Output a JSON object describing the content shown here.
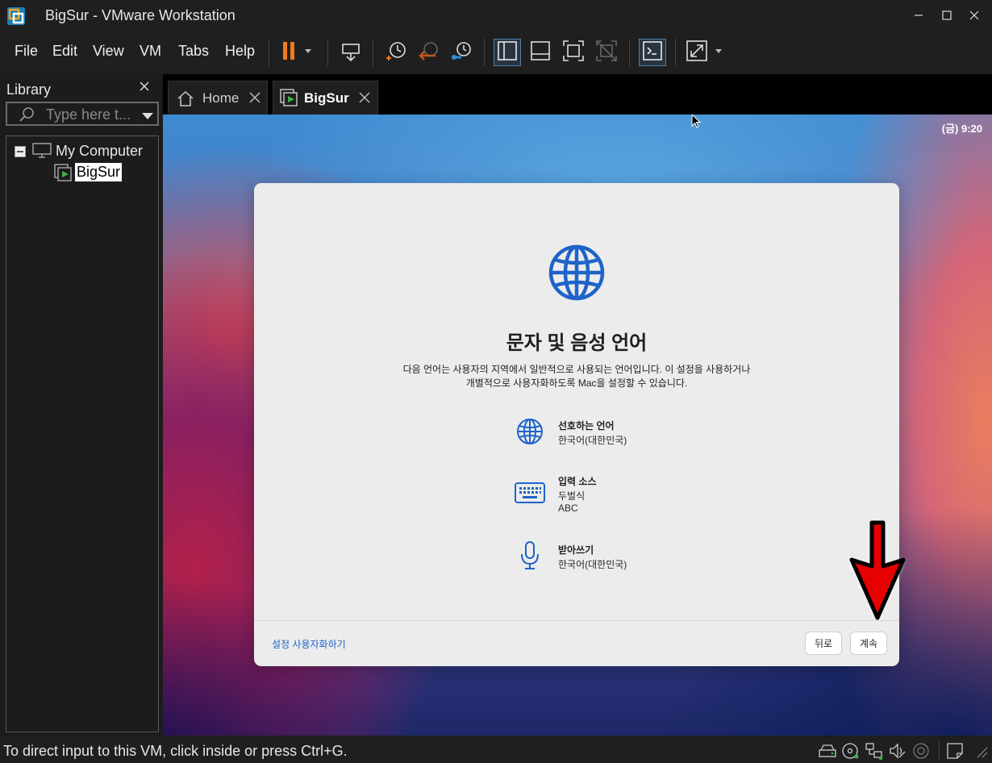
{
  "window": {
    "title": "BigSur - VMware Workstation"
  },
  "menu": {
    "items": [
      "File",
      "Edit",
      "View",
      "VM",
      "Tabs",
      "Help"
    ]
  },
  "toolbar": {
    "icons": [
      "pause-icon",
      "send-ctrl-alt-del-icon",
      "snapshot-take-icon",
      "snapshot-revert-icon",
      "snapshot-manager-icon",
      "show-library-icon",
      "thumbnail-bar-icon",
      "full-screen-icon",
      "unity-icon",
      "console-view-icon",
      "stretch-icon"
    ],
    "accent_pause": "#f07a1a"
  },
  "library": {
    "title": "Library",
    "search_placeholder": "Type here t...",
    "tree": {
      "root": "My Computer",
      "child": "BigSur"
    }
  },
  "tabs": [
    {
      "label": "Home",
      "active": false
    },
    {
      "label": "BigSur",
      "active": true
    }
  ],
  "vm": {
    "clock": "(금)  9:20",
    "dialog": {
      "title": "문자 및 음성 언어",
      "description_line1": "다음 언어는 사용자의 지역에서 일반적으로 사용되는 언어입니다. 이 설정을 사용하거나",
      "description_line2": "개별적으로 사용자화하도록 Mac을 설정할 수 있습니다.",
      "options": [
        {
          "icon": "globe-icon",
          "title": "선호하는 언어",
          "values": [
            "한국어(대한민국)"
          ]
        },
        {
          "icon": "keyboard-icon",
          "title": "입력 소스",
          "values": [
            "두벌식",
            "ABC"
          ]
        },
        {
          "icon": "microphone-icon",
          "title": "받아쓰기",
          "values": [
            "한국어(대한민국)"
          ]
        }
      ],
      "customize_link": "설정 사용자화하기",
      "back_button": "뒤로",
      "continue_button": "계속",
      "accent": "#1e64c8"
    }
  },
  "statusbar": {
    "text": "To direct input to this VM, click inside or press Ctrl+G."
  }
}
